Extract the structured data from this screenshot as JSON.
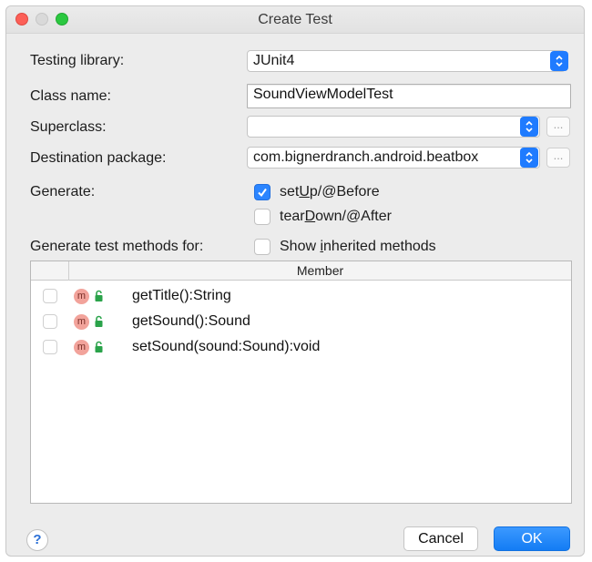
{
  "window": {
    "title": "Create Test"
  },
  "form": {
    "testing_library": {
      "label": "Testing library:",
      "value": "JUnit4"
    },
    "class_name": {
      "label": "Class name:",
      "value": "SoundViewModelTest"
    },
    "superclass": {
      "label": "Superclass:",
      "value": "",
      "browse": "..."
    },
    "destination_package": {
      "label": "Destination package:",
      "value": "com.bignerdranch.android.beatbox",
      "browse": "..."
    },
    "generate": {
      "label": "Generate:",
      "options": [
        {
          "pre": "set",
          "mnemonic": "U",
          "post": "p/@Before",
          "checked": true
        },
        {
          "pre": "tear",
          "mnemonic": "D",
          "post": "own/@After",
          "checked": false
        }
      ]
    },
    "methods_for": {
      "label": "Generate test methods for:"
    },
    "show_inherited": {
      "pre": "Show ",
      "mnemonic": "i",
      "post": "nherited methods",
      "checked": false
    }
  },
  "table": {
    "header": "Member",
    "rows": [
      {
        "method": "getTitle():String",
        "checked": false,
        "icon": "method-icon",
        "badge": "m"
      },
      {
        "method": "getSound():Sound",
        "checked": false,
        "icon": "method-icon",
        "badge": "m"
      },
      {
        "method": "setSound(sound:Sound):void",
        "checked": false,
        "icon": "method-icon",
        "badge": "m"
      }
    ]
  },
  "footer": {
    "help": "?",
    "cancel": "Cancel",
    "ok": "OK"
  },
  "colors": {
    "accent": "#1f7bff",
    "method_badge": "#f2a39b",
    "lock": "#2aa34a"
  }
}
